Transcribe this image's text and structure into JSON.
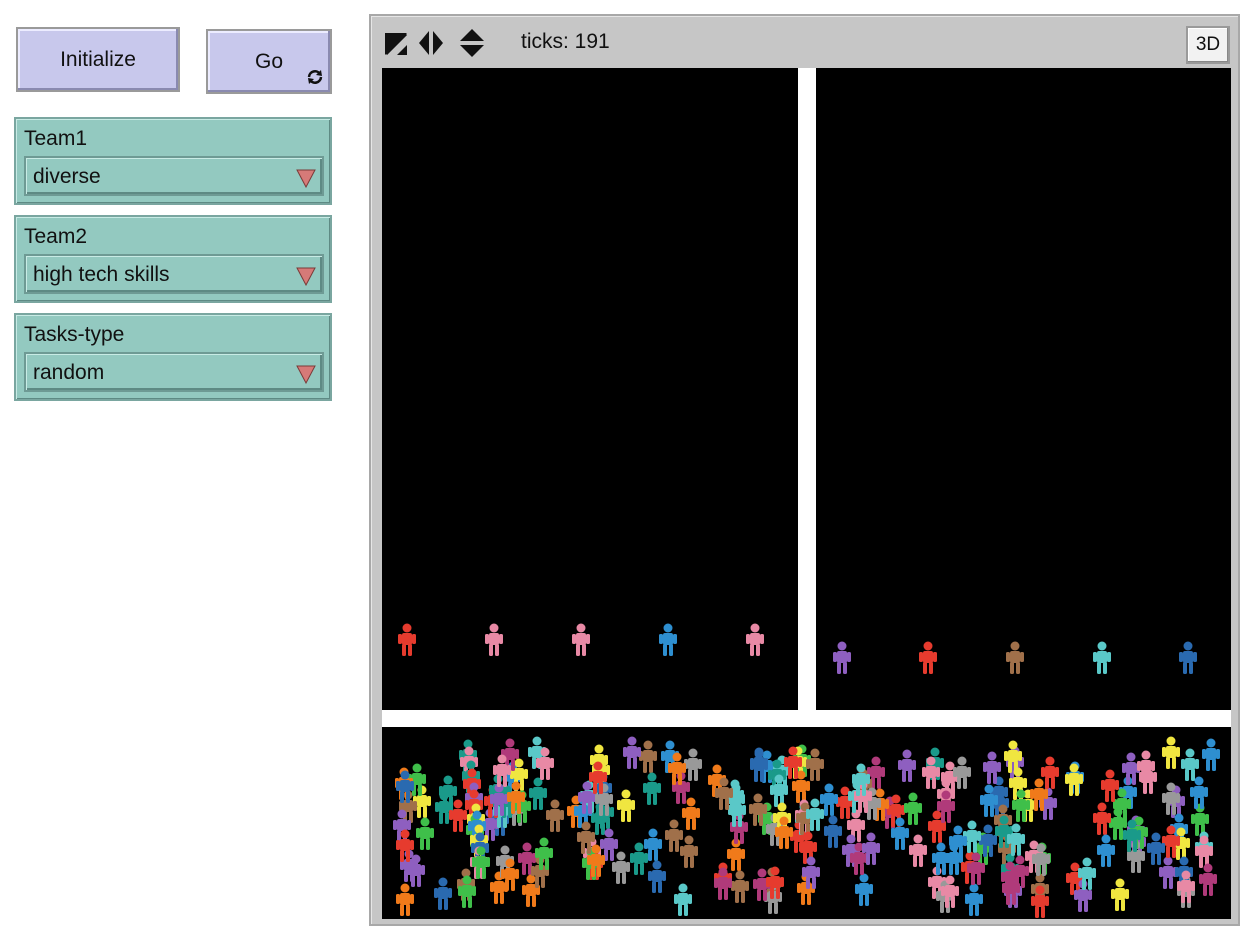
{
  "buttons": {
    "initialize_label": "Initialize",
    "go_label": "Go"
  },
  "choosers": {
    "team1": {
      "label": "Team1",
      "value": "diverse"
    },
    "team2": {
      "label": "Team2",
      "value": "high tech skills"
    },
    "tasks_type": {
      "label": "Tasks-type",
      "value": "random"
    }
  },
  "view": {
    "ticks_label": "ticks: 191",
    "button_3d_label": "3D"
  },
  "colors": {
    "world_background": "#000000",
    "patch_divider": "#ffffff",
    "button_fill": "#c8c8ec",
    "chooser_fill": "#93c9c0"
  },
  "icons": [
    "resize-diagonal-icon",
    "resize-horizontal-icon",
    "resize-vertical-icon",
    "forever-icon",
    "dropdown-arrow-icon"
  ]
}
